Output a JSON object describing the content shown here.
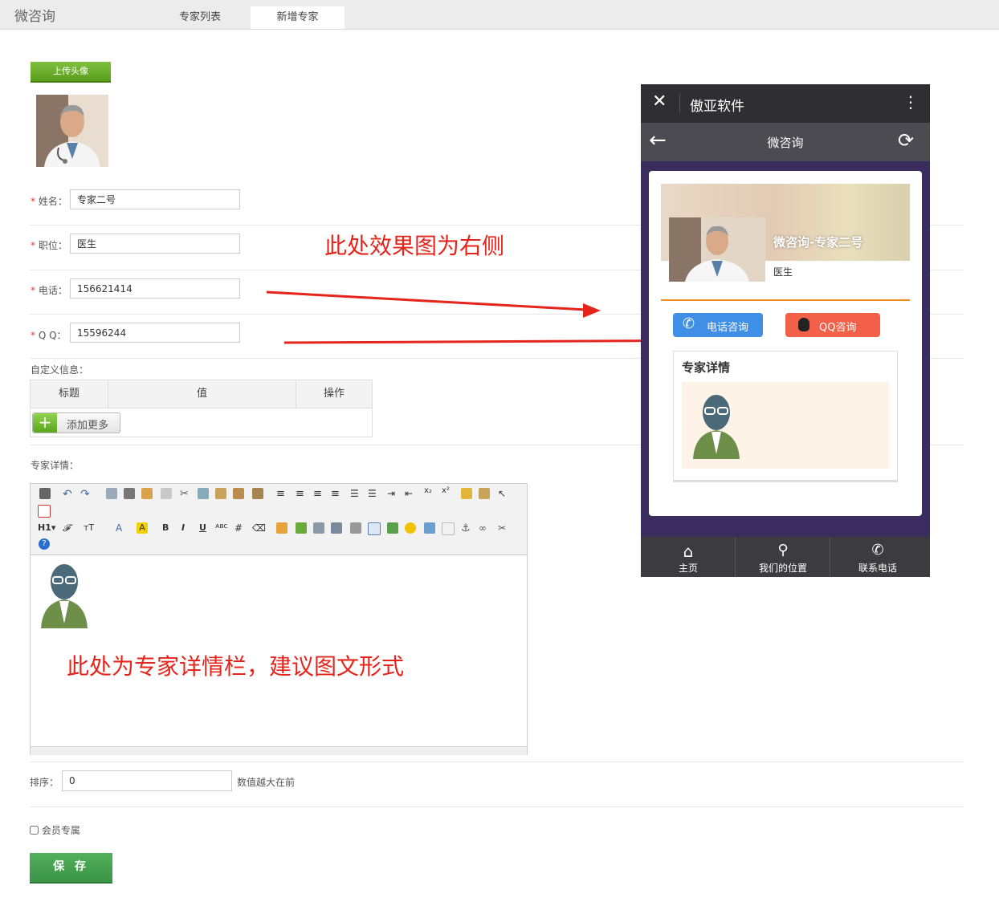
{
  "app": {
    "title": "微咨询"
  },
  "tabs": [
    {
      "label": "专家列表",
      "active": false
    },
    {
      "label": "新增专家",
      "active": true
    }
  ],
  "form": {
    "upload_label": "上传头像",
    "name": {
      "label": "姓名：",
      "value": "专家二号"
    },
    "position": {
      "label": "职位：",
      "value": "医生"
    },
    "phone": {
      "label": "电话：",
      "value": "156621414"
    },
    "qq": {
      "label": "Q Q：",
      "value": "15596244"
    },
    "required_mark": "*",
    "custom_info": {
      "label": "自定义信息：",
      "columns": [
        "标题",
        "值",
        "操作"
      ],
      "add_more_label": "添加更多"
    },
    "details_label": "专家详情：",
    "sort": {
      "label": "排序：",
      "value": "0",
      "hint": "数值越大在前"
    },
    "member_only": {
      "label": "会员专属",
      "checked": false
    },
    "save_label": "保 存"
  },
  "editor_toolbar": {
    "heading": "H1",
    "bold": "B",
    "italic": "I",
    "underline": "U"
  },
  "notes": {
    "preview_note": "此处效果图为右侧",
    "details_note": "此处为专家详情栏，建议图文形式"
  },
  "phone_preview": {
    "window_title": "傲亚软件",
    "page_title": "微咨询",
    "expert_title": "微咨询-专家二号",
    "position": "医生",
    "call_button": "电话咨询",
    "qq_button": "QQ咨询",
    "details_heading": "专家详情",
    "bottom_nav": [
      "主页",
      "我们的位置",
      "联系电话"
    ],
    "accent_color": "#f08a24"
  }
}
